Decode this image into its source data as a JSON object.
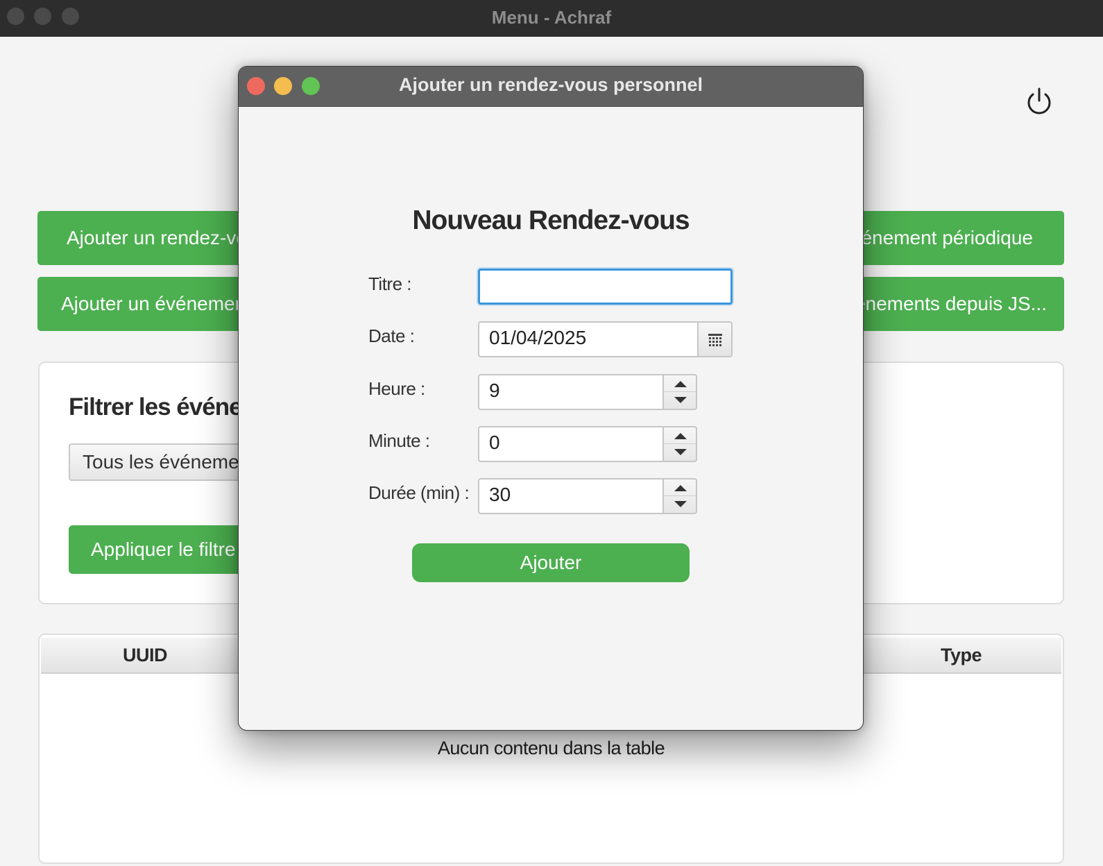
{
  "main_window": {
    "title": "Menu - Achraf",
    "buttons": {
      "add_rdv_personal": "Ajouter un rendez-vous personnel",
      "add_event_periodic": "Ajouter un événement périodique",
      "add_event": "Ajouter un événement",
      "import_json": "Importer des événements depuis JS..."
    },
    "filter": {
      "title": "Filtrer les événements",
      "selected_option": "Tous les événements",
      "apply_label": "Appliquer le filtre"
    },
    "table": {
      "columns": [
        "UUID",
        "Type"
      ],
      "empty_message": "Aucun contenu dans la table"
    },
    "power_icon": "power-icon"
  },
  "dialog": {
    "title": "Ajouter un rendez-vous personnel",
    "heading": "Nouveau Rendez-vous",
    "fields": {
      "title_label": "Titre :",
      "title_value": "",
      "date_label": "Date :",
      "date_value": "01/04/2025",
      "hour_label": "Heure :",
      "hour_value": "9",
      "minute_label": "Minute :",
      "minute_value": "0",
      "duration_label": "Durée (min) :",
      "duration_value": "30"
    },
    "submit_label": "Ajouter",
    "traffic_lights": {
      "close": "#ee6a5f",
      "minimize": "#f5bd4f",
      "zoom": "#61c454"
    }
  },
  "colors": {
    "accent_green": "#4caf50",
    "focus_blue": "#3a96dd"
  }
}
